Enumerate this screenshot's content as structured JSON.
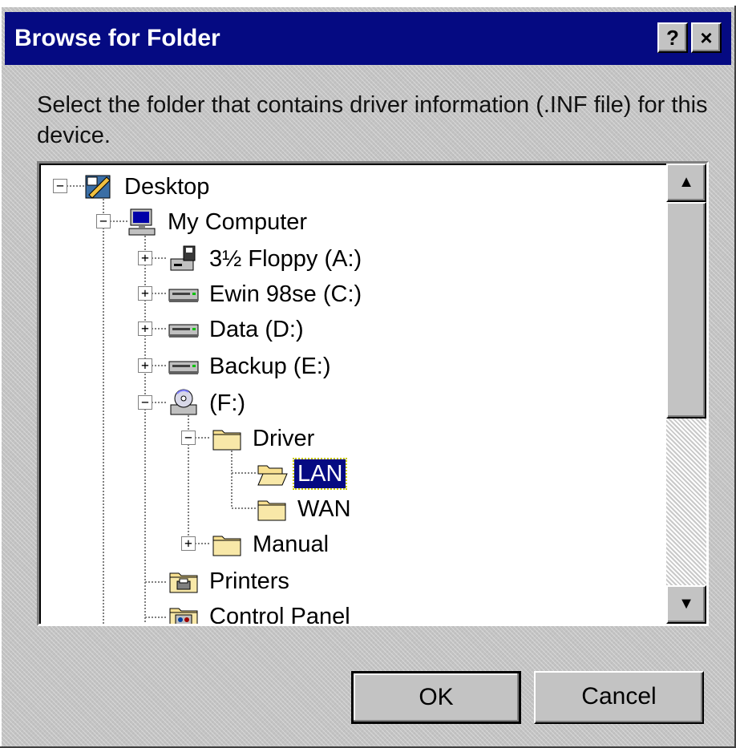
{
  "window": {
    "title": "Browse for Folder",
    "help_label": "?",
    "close_label": "×"
  },
  "instruction": "Select the folder that contains driver information (.INF file) for this device.",
  "tree": {
    "items": [
      {
        "label": "Desktop",
        "icon": "desktop-icon",
        "expander": "−"
      },
      {
        "label": "My Computer",
        "icon": "computer-icon",
        "expander": "−"
      },
      {
        "label": "3½ Floppy (A:)",
        "icon": "floppy-icon",
        "expander": "+"
      },
      {
        "label": "Ewin 98se (C:)",
        "icon": "drive-icon",
        "expander": "+"
      },
      {
        "label": "Data (D:)",
        "icon": "drive-icon",
        "expander": "+"
      },
      {
        "label": "Backup (E:)",
        "icon": "drive-icon",
        "expander": "+"
      },
      {
        "label": "(F:)",
        "icon": "cd-drive-icon",
        "expander": "−"
      },
      {
        "label": "Driver",
        "icon": "folder-icon",
        "expander": "−"
      },
      {
        "label": "LAN",
        "icon": "open-folder-icon",
        "expander": ""
      },
      {
        "label": "WAN",
        "icon": "folder-icon",
        "expander": ""
      },
      {
        "label": "Manual",
        "icon": "folder-icon",
        "expander": "+"
      },
      {
        "label": "Printers",
        "icon": "printers-folder-icon",
        "expander": ""
      },
      {
        "label": "Control Panel",
        "icon": "control-panel-icon",
        "expander": ""
      }
    ],
    "selected": "LAN"
  },
  "scrollbar": {
    "up_label": "▲",
    "down_label": "▼"
  },
  "buttons": {
    "ok_label": "OK",
    "cancel_label": "Cancel"
  },
  "colors": {
    "titlebar": "#050a82",
    "selection": "#050a82",
    "face": "#c3c3c3"
  }
}
